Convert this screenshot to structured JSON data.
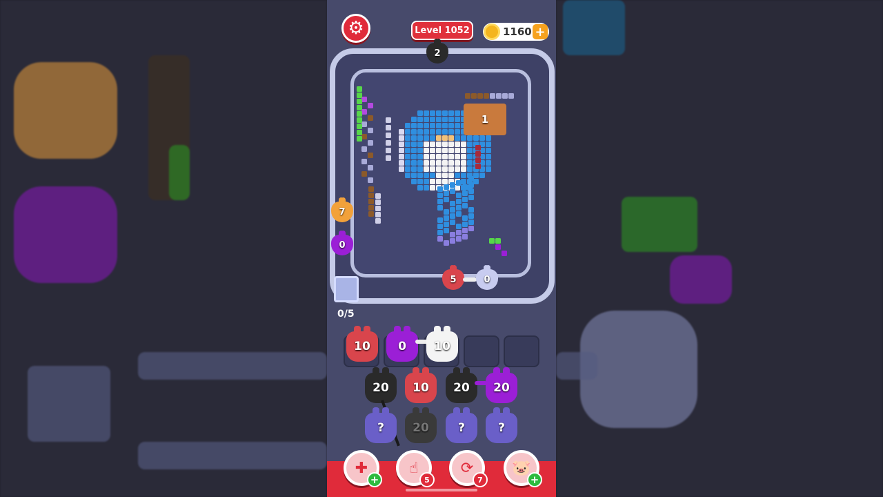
{
  "header": {
    "level_label": "Level 1052",
    "coins": "1160",
    "coin_add": "+",
    "settings_icon": "gear-icon"
  },
  "track": {
    "entry_pig_count": "2",
    "side_pigs": [
      {
        "count": "7",
        "color": "#f2a13a"
      },
      {
        "count": "0",
        "color": "#9b1fd6"
      }
    ],
    "bottom_pigs": [
      {
        "count": "5",
        "color": "#d9454c"
      },
      {
        "count": "0",
        "color": "#c8ccf0"
      }
    ],
    "box_count": "1",
    "progress": "0/5"
  },
  "queue": {
    "slots": [
      {
        "count": "10",
        "color": "#d9454c"
      },
      {
        "count": "0",
        "color": "#9b1fd6"
      },
      {
        "count": "10",
        "color": "#f4f4f4"
      },
      {
        "empty": true
      },
      {
        "empty": true
      }
    ]
  },
  "grid": {
    "row1": [
      {
        "count": "20",
        "color": "#2a2a2a"
      },
      {
        "count": "10",
        "color": "#d9454c"
      },
      {
        "count": "20",
        "color": "#2a2a2a"
      },
      {
        "count": "20",
        "color": "#9b1fd6"
      }
    ],
    "row2": [
      {
        "count": "?",
        "color": "#6a5fc8"
      },
      {
        "count": "20",
        "color": "#3a3a3a"
      },
      {
        "count": "?",
        "color": "#6a5fc8"
      },
      {
        "count": "?",
        "color": "#6a5fc8"
      }
    ]
  },
  "tools": [
    {
      "name": "add-slot",
      "icon": "add-slot-icon",
      "badge": "+",
      "badge_type": "green"
    },
    {
      "name": "hand",
      "icon": "hand-icon",
      "badge": "5",
      "badge_type": "red"
    },
    {
      "name": "shuffle",
      "icon": "shuffle-icon",
      "badge": "7",
      "badge_type": "red"
    },
    {
      "name": "magnet-pig",
      "icon": "pig-icon",
      "badge": "+",
      "badge_type": "green"
    }
  ],
  "colors": {
    "accent_red": "#e02b3a",
    "phone_bg": "#474a6b",
    "track": "#c5cbe8"
  }
}
